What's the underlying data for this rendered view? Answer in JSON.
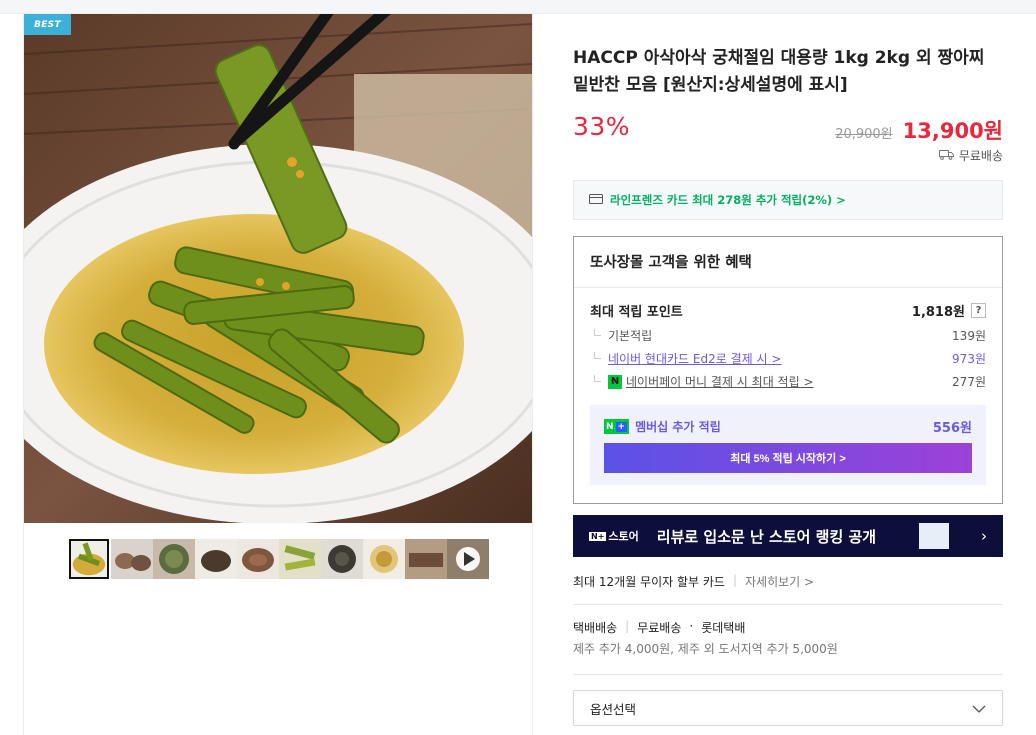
{
  "gallery": {
    "badge": "BEST",
    "thumbnail_count": 10
  },
  "product": {
    "title": "HACCP 아삭아삭 궁채절임 대용량 1kg 2kg 외 짱아찌 밑반찬 모음 [원산지:상세설명에 표시]",
    "discount": "33%",
    "original_price": "20,900원",
    "sale_price": "13,900원",
    "delivery_label": "무료배송"
  },
  "card_promo": {
    "text": "라인프렌즈 카드 최대 278원 추가 적립(2%) >"
  },
  "benefit": {
    "heading": "또사장몰 고객을 위한 혜택",
    "max_points_label": "최대 적립 포인트",
    "max_points_value": "1,818원",
    "help_glyph": "?",
    "items": [
      {
        "label": "기본적립",
        "value": "139원"
      },
      {
        "label": "네이버 현대카드 Ed2로 결제 시 >",
        "value": "973원"
      },
      {
        "label": "네이버페이 머니 결제 시 최대 적립 >",
        "value": "277원"
      }
    ],
    "npay_glyph": "N",
    "membership": {
      "n_glyph": "N",
      "plus_glyph": "+",
      "label": "멤버십 추가 적립",
      "value": "556원",
      "button": "최대 5% 적립 시작하기 >"
    }
  },
  "banner": {
    "logo_n": "N+",
    "logo_text": "스토어",
    "text": "리뷰로 입소문 난 스토어 랭킹 공개",
    "arrow": "›"
  },
  "installment": {
    "text": "최대 12개월 무이자 할부 카드",
    "detail": "자세히보기 >"
  },
  "shipping": {
    "type": "택배배송",
    "free": "무료배송",
    "dot": "·",
    "carrier": "롯데택배",
    "extra": "제주 추가 4,000원, 제주 외 도서지역 추가 5,000원"
  },
  "option": {
    "label": "옵션선택"
  },
  "colors": {
    "accent_red": "#e8273d",
    "naver_green": "#00b15e",
    "membership_purple": "#6c59e0",
    "banner_navy": "#0d0e3a"
  }
}
